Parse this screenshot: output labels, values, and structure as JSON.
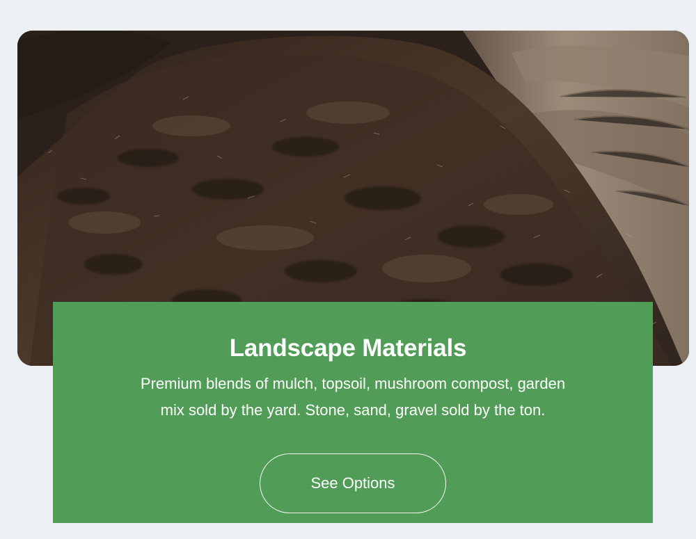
{
  "hero": {
    "image_name": "soil-pile-image"
  },
  "card": {
    "title": "Landscape Materials",
    "description": "Premium blends of mulch, topsoil, mushroom compost, garden mix sold by the yard. Stone, sand, gravel sold by the ton.",
    "button_label": "See Options"
  },
  "colors": {
    "page_background": "#eceff3",
    "card_green": "#519d57",
    "text": "#ffffff"
  }
}
